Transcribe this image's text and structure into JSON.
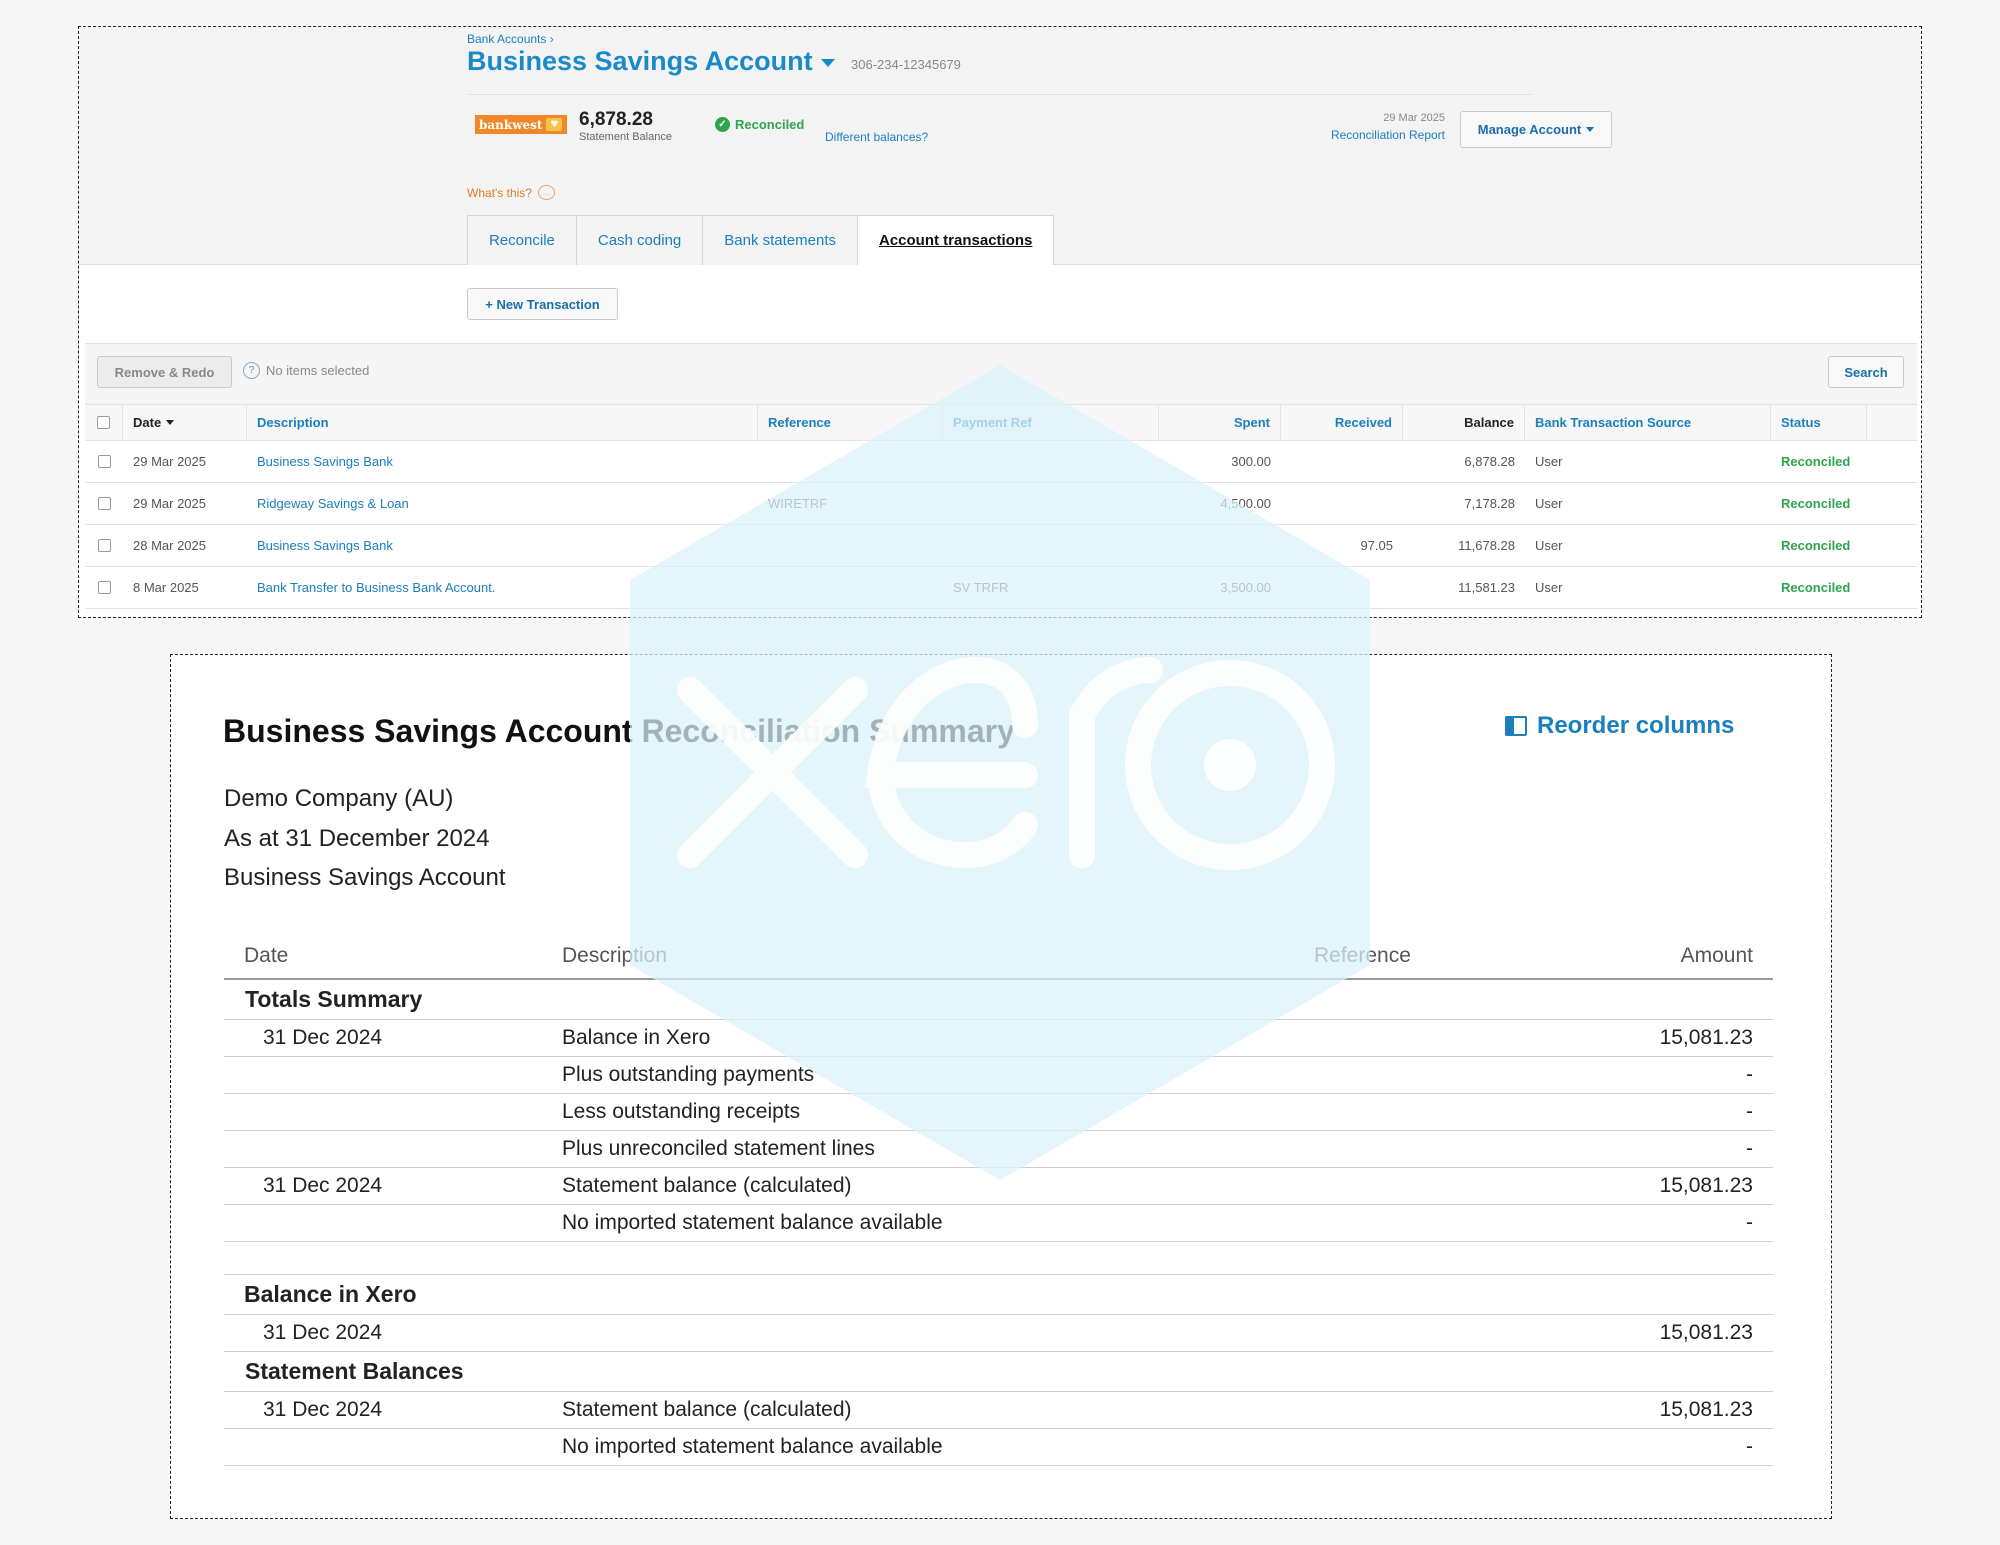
{
  "header": {
    "breadcrumb": "Bank Accounts ›",
    "account_title": "Business Savings Account",
    "account_number": "306-234-12345679",
    "bank_logo_text": "bankwest",
    "statement_balance": "6,878.28",
    "statement_balance_label": "Statement Balance",
    "reconciled_label": "Reconciled",
    "different_balances": "Different balances?",
    "recon_date": "29 Mar 2025",
    "recon_report": "Reconciliation Report",
    "manage_account": "Manage Account",
    "whats_this": "What's this?"
  },
  "tabs": [
    {
      "label": "Reconcile",
      "active": false
    },
    {
      "label": "Cash coding",
      "active": false
    },
    {
      "label": "Bank statements",
      "active": false
    },
    {
      "label": "Account transactions",
      "active": true
    }
  ],
  "actions": {
    "new_transaction": "+ New Transaction",
    "remove_redo": "Remove & Redo",
    "no_items": "No items selected",
    "search": "Search"
  },
  "grid": {
    "columns": {
      "date": "Date",
      "description": "Description",
      "reference": "Reference",
      "payment_ref": "Payment Ref",
      "spent": "Spent",
      "received": "Received",
      "balance": "Balance",
      "source": "Bank Transaction Source",
      "status": "Status"
    },
    "rows": [
      {
        "date": "29 Mar 2025",
        "description": "Business Savings Bank",
        "reference": "",
        "payment_ref": "",
        "spent": "300.00",
        "received": "",
        "balance": "6,878.28",
        "source": "User",
        "status": "Reconciled"
      },
      {
        "date": "29 Mar 2025",
        "description": "Ridgeway Savings & Loan",
        "reference": "WIRETRF",
        "payment_ref": "",
        "spent": "4,500.00",
        "received": "",
        "balance": "7,178.28",
        "source": "User",
        "status": "Reconciled"
      },
      {
        "date": "28 Mar 2025",
        "description": "Business Savings Bank",
        "reference": "",
        "payment_ref": "",
        "spent": "",
        "received": "97.05",
        "balance": "11,678.28",
        "source": "User",
        "status": "Reconciled"
      },
      {
        "date": "8 Mar 2025",
        "description": "Bank Transfer to Business Bank Account.",
        "reference": "",
        "payment_ref": "SV TRFR",
        "spent": "3,500.00",
        "received": "",
        "balance": "11,581.23",
        "source": "User",
        "status": "Reconciled"
      }
    ]
  },
  "report": {
    "title": "Business Savings Account Reconciliation Summary",
    "reorder_columns": "Reorder columns",
    "company": "Demo Company (AU)",
    "as_at": "As at 31 December 2024",
    "account": "Business Savings Account",
    "columns": {
      "date": "Date",
      "description": "Description",
      "reference": "Reference",
      "amount": "Amount"
    },
    "sections": {
      "totals": "Totals Summary",
      "balance_in_xero": "Balance in Xero",
      "statement_balances": "Statement Balances"
    },
    "totals_rows": [
      {
        "date": "31 Dec 2024",
        "description": "Balance in Xero",
        "amount": "15,081.23"
      },
      {
        "date": "",
        "description": "Plus outstanding payments",
        "amount": "-"
      },
      {
        "date": "",
        "description": "Less outstanding receipts",
        "amount": "-"
      },
      {
        "date": "",
        "description": "Plus unreconciled statement lines",
        "amount": "-"
      },
      {
        "date": "31 Dec 2024",
        "description": "Statement balance (calculated)",
        "amount": "15,081.23"
      },
      {
        "date": "",
        "description": "No imported statement balance available",
        "amount": "-"
      }
    ],
    "xero_rows": [
      {
        "date": "31 Dec 2024",
        "description": "",
        "amount": "15,081.23"
      }
    ],
    "statement_rows": [
      {
        "date": "31 Dec 2024",
        "description": "Statement balance (calculated)",
        "amount": "15,081.23"
      },
      {
        "date": "",
        "description": "No imported statement balance available",
        "amount": "-"
      }
    ]
  },
  "watermark": {
    "icon": "xero-logo-icon",
    "color": "#d9f1fb"
  }
}
